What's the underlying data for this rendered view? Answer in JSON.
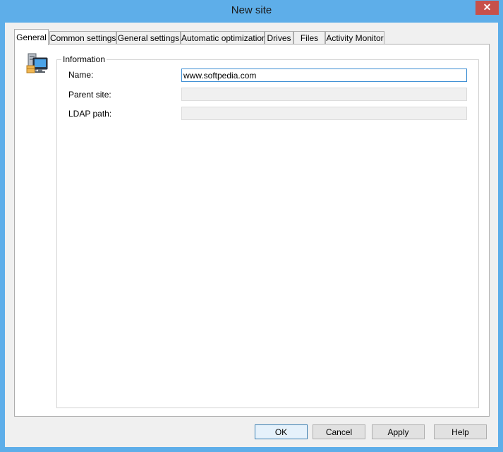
{
  "window": {
    "title": "New site",
    "close_glyph": "✕"
  },
  "tabs": [
    {
      "label": "General",
      "active": true
    },
    {
      "label": "Common settings",
      "active": false
    },
    {
      "label": "General settings",
      "active": false
    },
    {
      "label": "Automatic optimization",
      "active": false
    },
    {
      "label": "Drives",
      "active": false
    },
    {
      "label": "Files",
      "active": false
    },
    {
      "label": "Activity Monitor",
      "active": false
    }
  ],
  "information": {
    "group_label": "Information",
    "icon": "site-computer-icon",
    "fields": [
      {
        "label": "Name:",
        "value": "www.softpedia.com",
        "enabled": true
      },
      {
        "label": "Parent site:",
        "value": "",
        "enabled": false
      },
      {
        "label": "LDAP path:",
        "value": "",
        "enabled": false
      }
    ]
  },
  "buttons": {
    "ok": "OK",
    "cancel": "Cancel",
    "apply": "Apply",
    "help": "Help"
  },
  "colors": {
    "titlebar": "#5eaee9",
    "close_button": "#c7504a",
    "focus_border": "#3f8fd4"
  }
}
